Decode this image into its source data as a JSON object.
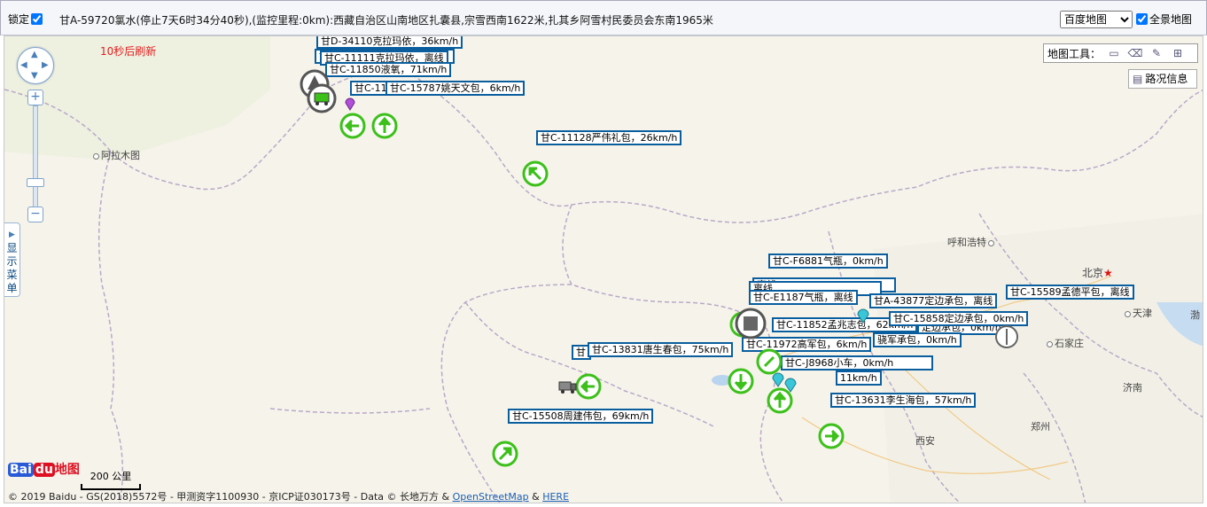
{
  "toolbar": {
    "lock_label": "锁定",
    "lock_checked": true,
    "status_text": "甘A-59720氯水(停止7天6时34分40秒),(监控里程:0km):西藏自治区山南地区扎囊县,宗雪西南1622米,扎其乡阿雪村民委员会东南1965米",
    "map_type_selected": "百度地图",
    "map_type_options": [
      "百度地图"
    ],
    "full_view_label": "全景地图",
    "full_view_checked": true
  },
  "map": {
    "refresh_text": "10秒后刷新",
    "side_menu_label": "显示菜单",
    "tools_label": "地图工具：",
    "tool_icons": [
      "ruler-icon",
      "eraser-icon",
      "pointer-icon",
      "grid-icon"
    ],
    "traffic_label": "路况信息",
    "scale_label": "200 公里",
    "logo_text_bai": "Bai",
    "logo_text_du": "du",
    "logo_text_map": "地图",
    "copyright_text": "© 2019 Baidu - GS(2018)5572号 - 甲测资字1100930 - 京ICP证030173号 - Data © 长地万方 &",
    "osm_link": "OpenStreetMap",
    "amp": "&",
    "here_link": "HERE"
  },
  "cities": [
    "阿拉木图",
    "呼和浩特",
    "北京",
    "天津",
    "石家庄",
    "济南",
    "郑州",
    "西安",
    "渤"
  ],
  "vehicle_labels": [
    "甘D-34110克拉玛依，36km/h",
    "甘C-11111克拉玛依，离线",
    "甘C-11850液氧，71km/h",
    "甘C-11",
    "甘C-15787姚天文包，6km/h",
    "甘C-11128严伟礼包，26km/h",
    "甘C-F6881气瓶，0km/h",
    "甘C-E1187气瓶，离线",
    "甘A-43877定边承包，离线",
    "甘C-15589孟德平包，离线",
    "甘C-11852孟兆志包，62km/h",
    "甘C-15858定边承包，0km/h",
    "甘C-11972高军包，6km/h",
    "甘C-13831唐生春包，75km/h",
    "甘C-J8968小车，0km/h",
    "甘C-13631李生海包，57km/h",
    "甘C-15508周建伟包，69km/h",
    "离线",
    "定边承包，0km/h",
    "骁军承包，0km/h",
    "11km/h",
    "甘"
  ],
  "colors": {
    "label_border": "#0a5e9e",
    "direction_green": "#3cc01a",
    "refresh_red": "#e02020",
    "province_border": "#b8a9c9"
  }
}
